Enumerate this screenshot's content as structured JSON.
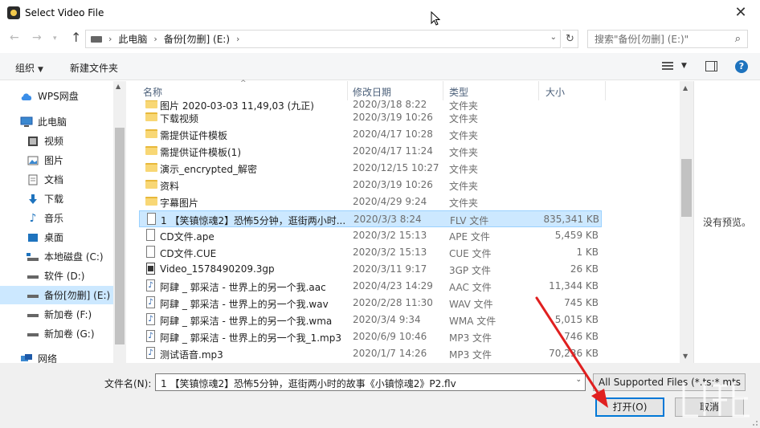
{
  "window": {
    "title": "Select Video File"
  },
  "address": {
    "crumbs": [
      "此电脑",
      "备份[勿删] (E:)"
    ],
    "search_placeholder": "搜索\"备份[勿删] (E:)\""
  },
  "toolbar": {
    "organize": "组织",
    "new_folder": "新建文件夹"
  },
  "sidebar": {
    "items": [
      {
        "label": "WPS网盘",
        "icon": "cloud-icon"
      },
      {
        "label": "此电脑",
        "icon": "computer-icon"
      },
      {
        "label": "视频",
        "icon": "video-folder-icon"
      },
      {
        "label": "图片",
        "icon": "pictures-folder-icon"
      },
      {
        "label": "文档",
        "icon": "documents-folder-icon"
      },
      {
        "label": "下载",
        "icon": "download-icon"
      },
      {
        "label": "音乐",
        "icon": "music-icon"
      },
      {
        "label": "桌面",
        "icon": "desktop-icon"
      },
      {
        "label": "本地磁盘 (C:)",
        "icon": "system-drive-icon"
      },
      {
        "label": "软件 (D:)",
        "icon": "drive-icon"
      },
      {
        "label": "备份[勿删] (E:)",
        "icon": "drive-icon",
        "selected": true
      },
      {
        "label": "新加卷 (F:)",
        "icon": "drive-icon"
      },
      {
        "label": "新加卷 (G:)",
        "icon": "drive-icon"
      },
      {
        "label": "网络",
        "icon": "network-icon"
      }
    ]
  },
  "columns": {
    "name": "名称",
    "date": "修改日期",
    "type": "类型",
    "size": "大小"
  },
  "files": [
    {
      "name": "图片 2020-03-03 11,49,03 (九正)",
      "date": "2020/3/18 8:22",
      "type": "文件夹",
      "size": "",
      "icon": "folder"
    },
    {
      "name": "下载视频",
      "date": "2020/3/19 10:26",
      "type": "文件夹",
      "size": "",
      "icon": "folder"
    },
    {
      "name": "需提供证件模板",
      "date": "2020/4/17 10:28",
      "type": "文件夹",
      "size": "",
      "icon": "folder"
    },
    {
      "name": "需提供证件模板(1)",
      "date": "2020/4/17 11:24",
      "type": "文件夹",
      "size": "",
      "icon": "folder"
    },
    {
      "name": "演示_encrypted_解密",
      "date": "2020/12/15 10:27",
      "type": "文件夹",
      "size": "",
      "icon": "folder"
    },
    {
      "name": "资料",
      "date": "2020/3/19 10:26",
      "type": "文件夹",
      "size": "",
      "icon": "folder"
    },
    {
      "name": "字幕图片",
      "date": "2020/4/29 9:24",
      "type": "文件夹",
      "size": "",
      "icon": "folder"
    },
    {
      "name": "1 【笑镇惊魂2】恐怖5分钟，逛街两小时...",
      "date": "2020/3/3 8:24",
      "type": "FLV 文件",
      "size": "835,341 KB",
      "icon": "doc",
      "selected": true
    },
    {
      "name": "CD文件.ape",
      "date": "2020/3/2 15:13",
      "type": "APE 文件",
      "size": "5,459 KB",
      "icon": "doc"
    },
    {
      "name": "CD文件.CUE",
      "date": "2020/3/2 15:13",
      "type": "CUE 文件",
      "size": "1 KB",
      "icon": "doc"
    },
    {
      "name": "Video_1578490209.3gp",
      "date": "2020/3/11 9:17",
      "type": "3GP 文件",
      "size": "26 KB",
      "icon": "video"
    },
    {
      "name": "阿肆 _ 郭采洁 - 世界上的另一个我.aac",
      "date": "2020/4/23 14:29",
      "type": "AAC 文件",
      "size": "11,344 KB",
      "icon": "music"
    },
    {
      "name": "阿肆 _ 郭采洁 - 世界上的另一个我.wav",
      "date": "2020/2/28 11:30",
      "type": "WAV 文件",
      "size": "745 KB",
      "icon": "music"
    },
    {
      "name": "阿肆 _ 郭采洁 - 世界上的另一个我.wma",
      "date": "2020/3/4 9:34",
      "type": "WMA 文件",
      "size": "5,015 KB",
      "icon": "music"
    },
    {
      "name": "阿肆 _ 郭采洁 - 世界上的另一个我_1.mp3",
      "date": "2020/6/9 10:46",
      "type": "MP3 文件",
      "size": "746 KB",
      "icon": "music"
    },
    {
      "name": "测试语音.mp3",
      "date": "2020/1/7 14:26",
      "type": "MP3 文件",
      "size": "70,236 KB",
      "icon": "music"
    }
  ],
  "preview": {
    "text": "没有预览。"
  },
  "bottom": {
    "filename_label": "文件名(N):",
    "filename_value": "1 【笑镇惊魂2】恐怖5分钟，逛街两小时的故事《小镇惊魂2》P2.flv",
    "filetype_value": "All Supported Files (*.ts;*.mts",
    "open_label": "打开(O)",
    "cancel_label": "取消"
  },
  "colors": {
    "selection": "#cce8ff",
    "accent": "#0078d7",
    "annotation_arrow": "#e02020"
  }
}
